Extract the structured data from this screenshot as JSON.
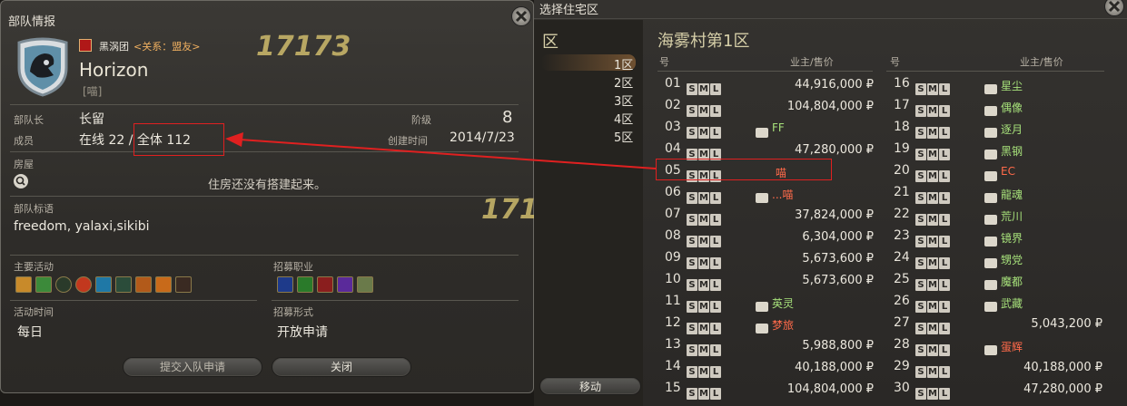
{
  "fc_window": {
    "title": "部队情报",
    "fc_tag": "黑涡团",
    "relation": "<关系：盟友>",
    "name": "Horizon",
    "short_tag": "[喵]",
    "leader_label": "部队长",
    "leader_value": "长留",
    "rank_label": "阶级",
    "rank_value": "8",
    "members_label": "成员",
    "members_value": "在线 22 / 全体 112",
    "created_label": "创建时间",
    "created_value": "2014/7/23",
    "housing_label": "房屋",
    "housing_value": "住房还没有搭建起来。",
    "slogan_label": "部队标语",
    "slogan_value": "freedom, yalaxi,sikibi",
    "activities_label": "主要活动",
    "recruit_jobs_label": "招募职业",
    "active_time_label": "活动时间",
    "active_time_value": "每日",
    "recruit_form_label": "招募形式",
    "recruit_form_value": "开放申请",
    "apply_button": "提交入队申请",
    "close_button": "关闭"
  },
  "housing_window": {
    "title": "选择住宅区",
    "ward_header": "区",
    "wards": [
      "1区",
      "2区",
      "3区",
      "4区",
      "5区"
    ],
    "selected_ward": "1区",
    "district_title": "海雾村第1区",
    "col_no": "号",
    "col_owner": "业主/售价",
    "move_button": "移动",
    "left_plots": [
      {
        "no": "01",
        "owner": "",
        "price": "44,916,000 ₽",
        "chat": false,
        "color": ""
      },
      {
        "no": "02",
        "owner": "",
        "price": "104,804,000 ₽",
        "chat": false,
        "color": ""
      },
      {
        "no": "03",
        "owner": "FF",
        "price": "",
        "chat": true,
        "color": "green"
      },
      {
        "no": "04",
        "owner": "",
        "price": "47,280,000 ₽",
        "chat": false,
        "color": ""
      },
      {
        "no": "05",
        "owner": "喵",
        "price": "",
        "chat": false,
        "color": "red"
      },
      {
        "no": "06",
        "owner": "...喵",
        "price": "",
        "chat": true,
        "color": "red"
      },
      {
        "no": "07",
        "owner": "",
        "price": "37,824,000 ₽",
        "chat": false,
        "color": ""
      },
      {
        "no": "08",
        "owner": "",
        "price": "6,304,000 ₽",
        "chat": false,
        "color": ""
      },
      {
        "no": "09",
        "owner": "",
        "price": "5,673,600 ₽",
        "chat": false,
        "color": ""
      },
      {
        "no": "10",
        "owner": "",
        "price": "5,673,600 ₽",
        "chat": false,
        "color": ""
      },
      {
        "no": "11",
        "owner": "英灵",
        "price": "",
        "chat": true,
        "color": "green"
      },
      {
        "no": "12",
        "owner": "梦旅",
        "price": "",
        "chat": true,
        "color": "red"
      },
      {
        "no": "13",
        "owner": "",
        "price": "5,988,800 ₽",
        "chat": false,
        "color": ""
      },
      {
        "no": "14",
        "owner": "",
        "price": "40,188,000 ₽",
        "chat": false,
        "color": ""
      },
      {
        "no": "15",
        "owner": "",
        "price": "104,804,000 ₽",
        "chat": false,
        "color": ""
      }
    ],
    "right_plots": [
      {
        "no": "16",
        "owner": "星尘",
        "price": "",
        "chat": true,
        "color": "green"
      },
      {
        "no": "17",
        "owner": "偶像",
        "price": "",
        "chat": true,
        "color": "green"
      },
      {
        "no": "18",
        "owner": "逐月",
        "price": "",
        "chat": true,
        "color": "green"
      },
      {
        "no": "19",
        "owner": "黑钢",
        "price": "",
        "chat": true,
        "color": "green"
      },
      {
        "no": "20",
        "owner": "EC",
        "price": "",
        "chat": true,
        "color": "red"
      },
      {
        "no": "21",
        "owner": "龍魂",
        "price": "",
        "chat": true,
        "color": "green"
      },
      {
        "no": "22",
        "owner": "荒川",
        "price": "",
        "chat": true,
        "color": "green"
      },
      {
        "no": "23",
        "owner": "镜界",
        "price": "",
        "chat": true,
        "color": "green"
      },
      {
        "no": "24",
        "owner": "甥党",
        "price": "",
        "chat": true,
        "color": "green"
      },
      {
        "no": "25",
        "owner": "魔都",
        "price": "",
        "chat": true,
        "color": "green"
      },
      {
        "no": "26",
        "owner": "武藏",
        "price": "",
        "chat": true,
        "color": "green"
      },
      {
        "no": "27",
        "owner": "",
        "price": "5,043,200 ₽",
        "chat": false,
        "color": ""
      },
      {
        "no": "28",
        "owner": "蛋辉",
        "price": "",
        "chat": true,
        "color": "red"
      },
      {
        "no": "29",
        "owner": "",
        "price": "40,188,000 ₽",
        "chat": false,
        "color": ""
      },
      {
        "no": "30",
        "owner": "",
        "price": "47,280,000 ₽",
        "chat": false,
        "color": ""
      }
    ],
    "size_labels": [
      "S",
      "M",
      "L"
    ]
  },
  "watermark": "17173",
  "colors": {
    "owner_green": "#a6e07a",
    "owner_red": "#ff6a4a",
    "highlight": "#e02020"
  }
}
